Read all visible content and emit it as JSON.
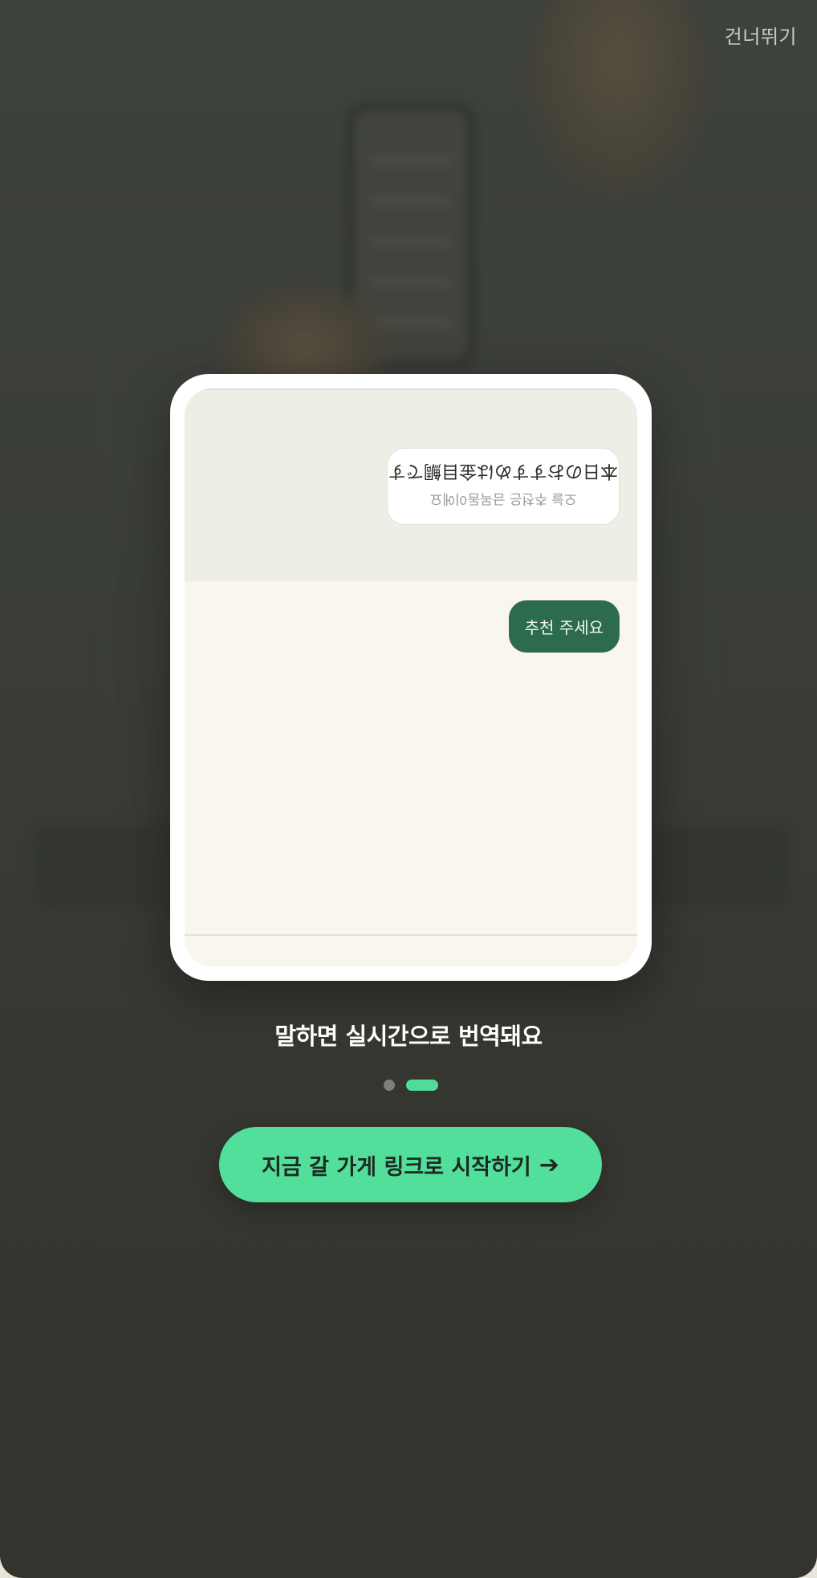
{
  "header": {
    "skip_label": "건너뛰기"
  },
  "demo": {
    "received_message": "本日のおすすめは金目鯛です",
    "received_translation": "오늘 추천은 금목돔이에요",
    "sent_message": "추천 주세요"
  },
  "onboarding": {
    "caption": "말하면 실시간으로 번역돼요",
    "pagination": {
      "current": 2,
      "total": 2
    }
  },
  "cta": {
    "label": "지금 갈 가게 링크로 시작하기",
    "arrow_icon": "arrow-right-icon",
    "arrow_glyph": "➔"
  },
  "colors": {
    "accent": "#52df9c",
    "sent_bubble": "#2c6b4d",
    "background": "#3a3d37"
  }
}
